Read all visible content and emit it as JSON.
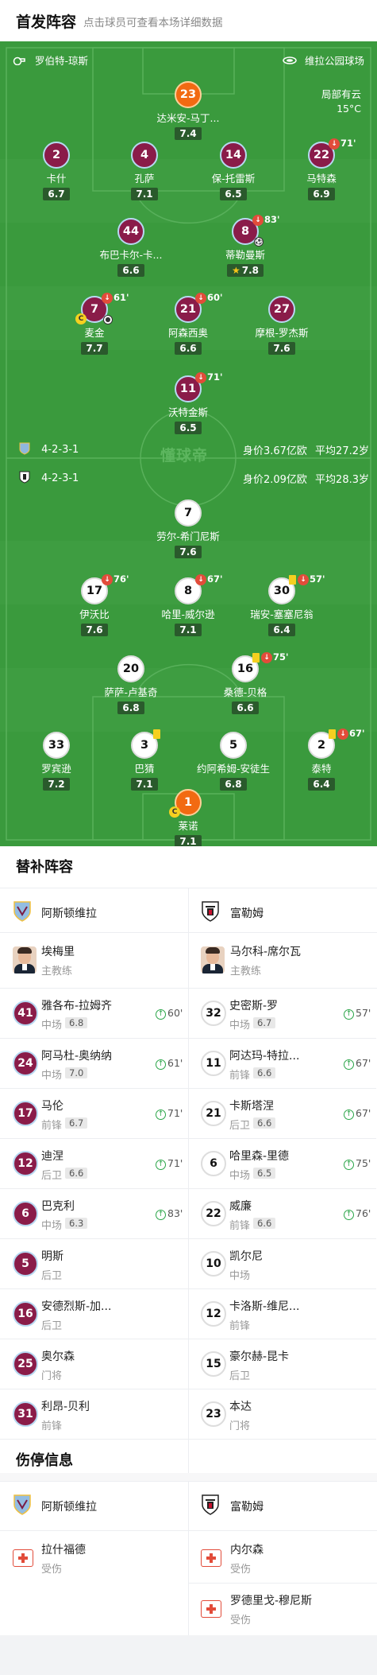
{
  "header": {
    "title": "首发阵容",
    "subtitle": "点击球员可查看本场详细数据"
  },
  "pitch_info": {
    "referee": "罗伯特-琼斯",
    "stadium": "维拉公园球场",
    "weather": "局部有云",
    "temperature": "15°C",
    "watermark": "懂球帝"
  },
  "home": {
    "name": "阿斯顿维拉",
    "formation": "4-2-3-1",
    "value": "身价3.67亿欧",
    "avg_age": "平均27.2岁"
  },
  "away": {
    "name": "富勒姆",
    "formation": "4-2-3-1",
    "value": "身价2.09亿欧",
    "avg_age": "平均28.3岁"
  },
  "home_lineup": [
    {
      "num": "23",
      "name": "达米安-马丁...",
      "rating": "7.4",
      "gk": true
    },
    {
      "num": "2",
      "name": "卡什",
      "rating": "6.7"
    },
    {
      "num": "4",
      "name": "孔萨",
      "rating": "7.1"
    },
    {
      "num": "14",
      "name": "保-托雷斯",
      "rating": "6.5"
    },
    {
      "num": "22",
      "name": "马特森",
      "rating": "6.9",
      "sub": "71'"
    },
    {
      "num": "44",
      "name": "布巴卡尔-卡...",
      "rating": "6.6"
    },
    {
      "num": "8",
      "name": "蒂勒曼斯",
      "rating": "7.8",
      "sub": "83'",
      "mvp": true
    },
    {
      "num": "7",
      "name": "麦金",
      "rating": "7.7",
      "sub": "61'",
      "captain": "C"
    },
    {
      "num": "21",
      "name": "阿森西奥",
      "rating": "6.6",
      "sub": "60'"
    },
    {
      "num": "27",
      "name": "摩根-罗杰斯",
      "rating": "7.6"
    },
    {
      "num": "11",
      "name": "沃特金斯",
      "rating": "6.5",
      "sub": "71'"
    }
  ],
  "away_lineup": [
    {
      "num": "7",
      "name": "劳尔-希门尼斯",
      "rating": "7.6"
    },
    {
      "num": "17",
      "name": "伊沃比",
      "rating": "7.6",
      "sub": "76'"
    },
    {
      "num": "8",
      "name": "哈里-威尔逊",
      "rating": "7.1",
      "sub": "67'"
    },
    {
      "num": "30",
      "name": "瑞安-塞塞尼翁",
      "rating": "6.4",
      "sub": "57'"
    },
    {
      "num": "20",
      "name": "萨萨-卢基奇",
      "rating": "6.8"
    },
    {
      "num": "16",
      "name": "桑德-贝格",
      "rating": "6.6",
      "sub": "75'"
    },
    {
      "num": "33",
      "name": "罗宾逊",
      "rating": "7.2"
    },
    {
      "num": "3",
      "name": "巴猜",
      "rating": "7.1"
    },
    {
      "num": "5",
      "name": "约阿希姆-安徒生",
      "rating": "6.8"
    },
    {
      "num": "2",
      "name": "泰特",
      "rating": "6.4",
      "sub": "67'"
    },
    {
      "num": "1",
      "name": "莱诺",
      "rating": "7.1",
      "gk": true,
      "captain": "C"
    }
  ],
  "subs_title": "替补阵容",
  "home_coach": {
    "name": "埃梅里",
    "role": "主教练"
  },
  "away_coach": {
    "name": "马尔科-席尔瓦",
    "role": "主教练"
  },
  "home_subs": [
    {
      "num": "41",
      "name": "雅各布-拉姆齐",
      "pos": "中场",
      "rating": "6.8",
      "in": "60'"
    },
    {
      "num": "24",
      "name": "阿马杜-奥纳纳",
      "pos": "中场",
      "rating": "7.0",
      "in": "61'"
    },
    {
      "num": "17",
      "name": "马伦",
      "pos": "前锋",
      "rating": "6.7",
      "in": "71'"
    },
    {
      "num": "12",
      "name": "迪涅",
      "pos": "后卫",
      "rating": "6.6",
      "in": "71'"
    },
    {
      "num": "6",
      "name": "巴克利",
      "pos": "中场",
      "rating": "6.3",
      "in": "83'"
    },
    {
      "num": "5",
      "name": "明斯",
      "pos": "后卫"
    },
    {
      "num": "16",
      "name": "安德烈斯-加...",
      "pos": "后卫"
    },
    {
      "num": "25",
      "name": "奥尔森",
      "pos": "门将"
    },
    {
      "num": "31",
      "name": "利昂-贝利",
      "pos": "前锋"
    }
  ],
  "away_subs": [
    {
      "num": "32",
      "name": "史密斯-罗",
      "pos": "中场",
      "rating": "6.7",
      "in": "57'"
    },
    {
      "num": "11",
      "name": "阿达玛-特拉...",
      "pos": "前锋",
      "rating": "6.6",
      "in": "67'"
    },
    {
      "num": "21",
      "name": "卡斯塔涅",
      "pos": "后卫",
      "rating": "6.6",
      "in": "67'"
    },
    {
      "num": "6",
      "name": "哈里森-里德",
      "pos": "中场",
      "rating": "6.5",
      "in": "75'"
    },
    {
      "num": "22",
      "name": "威廉",
      "pos": "前锋",
      "rating": "6.6",
      "in": "76'"
    },
    {
      "num": "10",
      "name": "凯尔尼",
      "pos": "中场"
    },
    {
      "num": "12",
      "name": "卡洛斯-维尼...",
      "pos": "前锋"
    },
    {
      "num": "15",
      "name": "豪尔赫-昆卡",
      "pos": "后卫"
    },
    {
      "num": "23",
      "name": "本达",
      "pos": "门将"
    }
  ],
  "injury_title": "伤停信息",
  "home_injuries": [
    {
      "name": "拉什福德",
      "status": "受伤"
    }
  ],
  "away_injuries": [
    {
      "name": "内尔森",
      "status": "受伤"
    },
    {
      "name": "罗德里戈-穆尼斯",
      "status": "受伤"
    }
  ]
}
